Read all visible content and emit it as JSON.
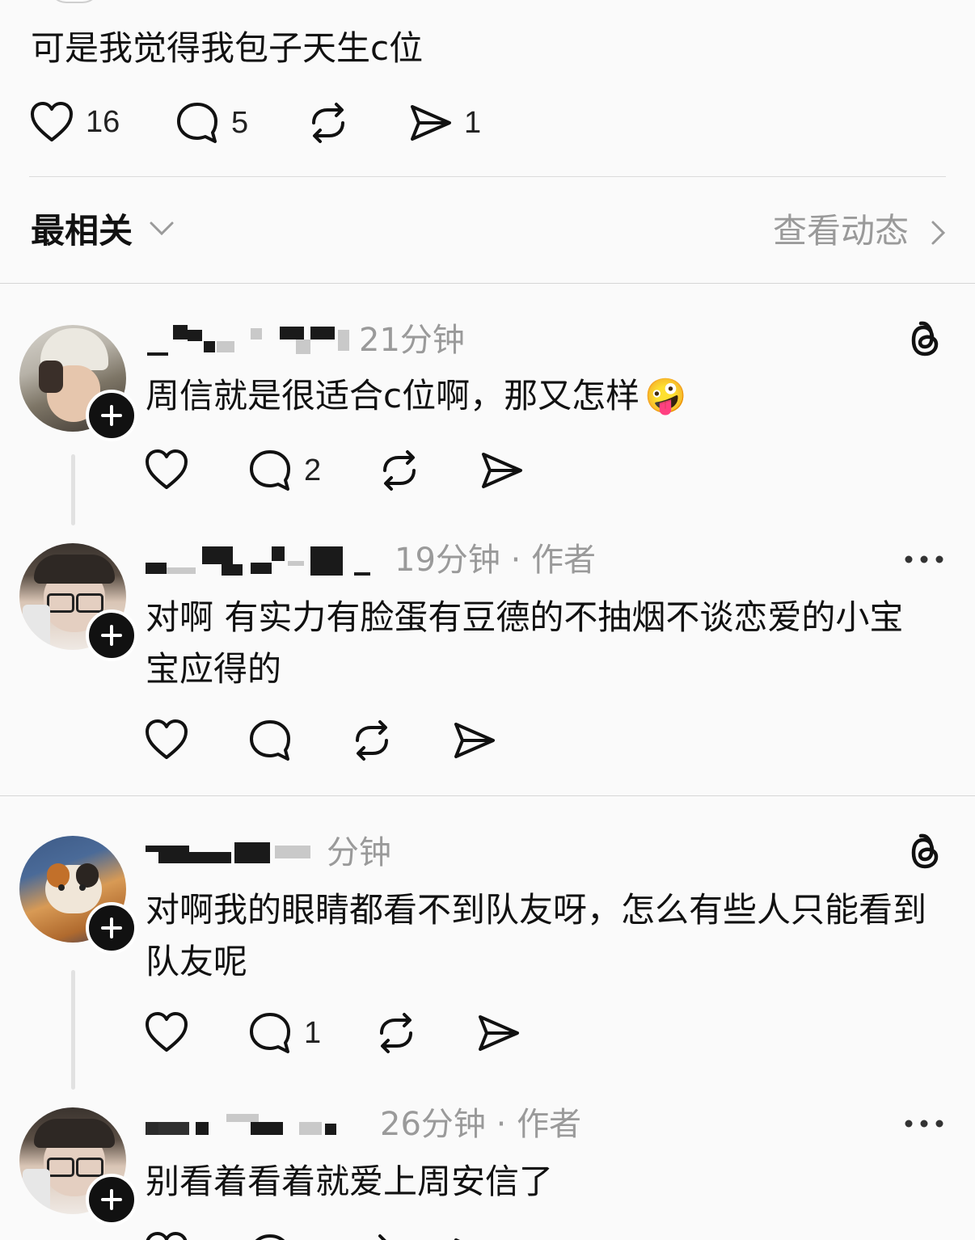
{
  "post": {
    "text": "可是我觉得我包子天生c位",
    "likes": "16",
    "replies": "5",
    "shares": "1"
  },
  "sort": {
    "label": "最相关",
    "view_activity": "查看动态"
  },
  "comments": [
    {
      "time": "21分钟",
      "text": "周信就是很适合c位啊，那又怎样",
      "emoji": "🤪",
      "replies": "2"
    },
    {
      "time": "19分钟",
      "author_tag": "作者",
      "text": "对啊 有实力有脸蛋有豆德的不抽烟不谈恋爱的小宝宝应得的"
    },
    {
      "time": "分钟",
      "text": "对啊我的眼睛都看不到队友呀，怎么有些人只能看到队友呢",
      "replies": "1"
    },
    {
      "time": "26分钟",
      "author_tag": "作者",
      "text": "别看着看着就爱上周安信了"
    }
  ],
  "icons": {
    "like": "heart-icon",
    "reply": "comment-bubble-icon",
    "repost": "repost-icon",
    "share": "send-icon",
    "threads": "threads-logo-icon",
    "more": "more-dots-icon",
    "follow": "plus-icon"
  }
}
